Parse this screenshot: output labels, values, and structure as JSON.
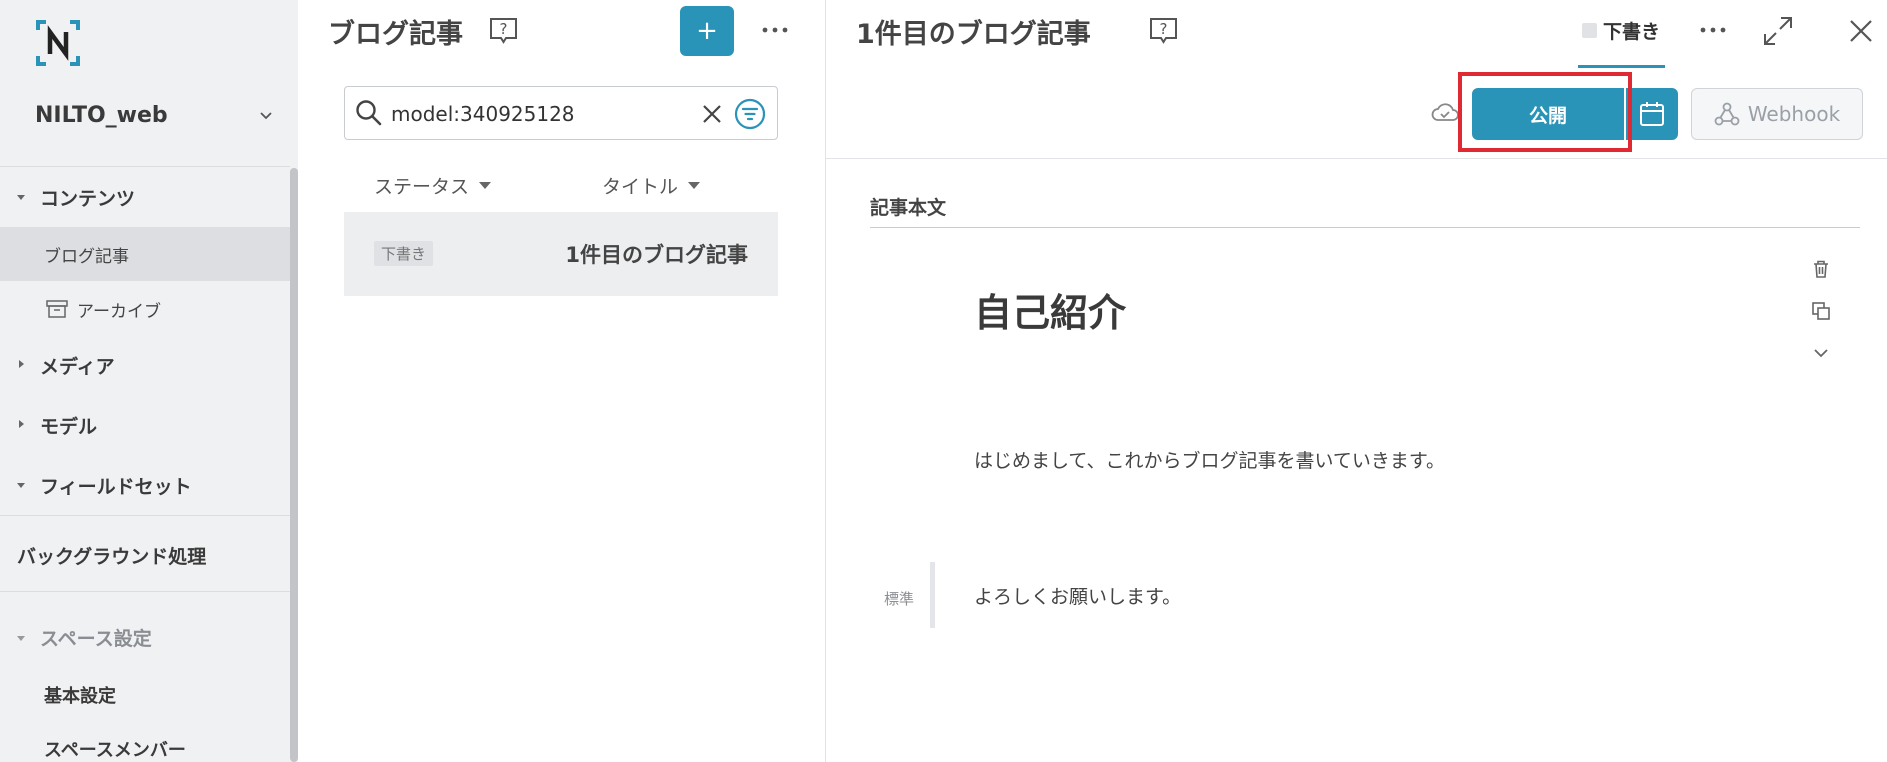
{
  "sidebar": {
    "space_name": "NILTO_web",
    "sections": {
      "contents": "コンテンツ",
      "blog": "ブログ記事",
      "archive": "アーカイブ",
      "media": "メディア",
      "model": "モデル",
      "fieldset": "フィールドセット",
      "background": "バックグラウンド処理",
      "space_settings": "スペース設定",
      "basic_settings": "基本設定",
      "space_members": "スペースメンバー"
    }
  },
  "list": {
    "title": "ブログ記事",
    "add_label": "+",
    "search_value": "model:340925128",
    "columns": {
      "status": "ステータス",
      "title": "タイトル"
    },
    "rows": [
      {
        "status": "下書き",
        "title": "1件目のブログ記事"
      }
    ]
  },
  "detail": {
    "title": "1件目のブログ記事",
    "status_tab": "下書き",
    "publish_label": "公開",
    "webhook_label": "Webhook",
    "field_label": "記事本文",
    "heading": "自己紹介",
    "paragraph_1": "はじめまして、これからブログ記事を書いていきます。",
    "style_label": "標準",
    "paragraph_2": "よろしくお願いします。"
  },
  "colors": {
    "accent": "#2a93b8",
    "highlight": "#e02a33",
    "sidebar_bg": "#f0f1f3"
  }
}
